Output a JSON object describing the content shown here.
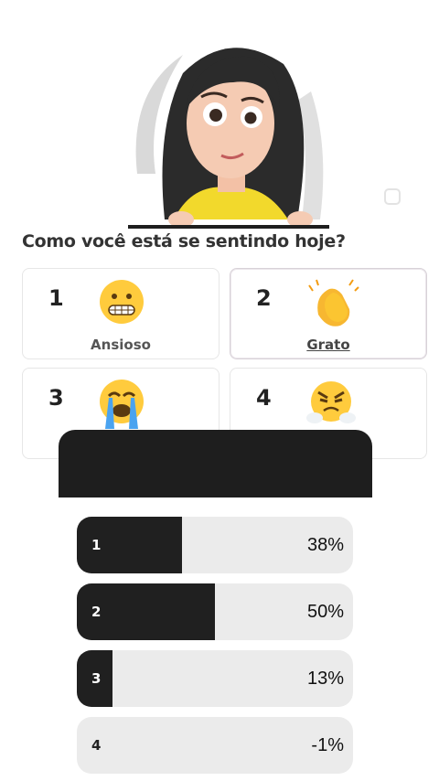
{
  "question": "Como você está se sentindo hoje?",
  "options": [
    {
      "number": "1",
      "label": "Ansioso",
      "emoji": "grimacing-face-icon",
      "selected": false
    },
    {
      "number": "2",
      "label": "Grato",
      "emoji": "clapping-hands-icon",
      "selected": true
    },
    {
      "number": "3",
      "label": "",
      "emoji": "loudly-crying-face-icon",
      "selected": false
    },
    {
      "number": "4",
      "label": "",
      "emoji": "face-with-steam-icon",
      "selected": false
    }
  ],
  "results": [
    {
      "number": "1",
      "percent_label": "38%",
      "fill": 0.38
    },
    {
      "number": "2",
      "percent_label": "50%",
      "fill": 0.5
    },
    {
      "number": "3",
      "percent_label": "13%",
      "fill": 0.13
    },
    {
      "number": "4",
      "percent_label": "-1%",
      "fill": 0.0
    }
  ],
  "colors": {
    "bar_fill": "#202020",
    "bar_track": "#ebebeb",
    "panel": "#1e1e1e"
  }
}
